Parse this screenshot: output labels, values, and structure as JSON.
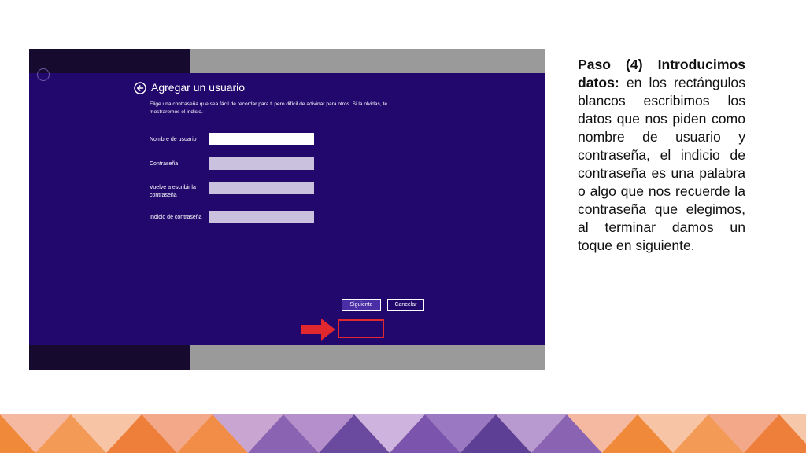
{
  "dialog": {
    "title": "Agregar un usuario",
    "description": "Elige una contraseña que sea fácil de recordar para ti pero difícil de adivinar para otros. Si la olvidas, te mostraremos el indicio.",
    "fields": [
      {
        "label": "Nombre de usuario",
        "value": ""
      },
      {
        "label": "Contraseña",
        "value": ""
      },
      {
        "label": "Vuelve a escribir la contraseña",
        "value": ""
      },
      {
        "label": "Indicio de contraseña",
        "value": ""
      }
    ],
    "buttons": {
      "next": "Siguiente",
      "cancel": "Cancelar"
    },
    "icons": {
      "back": "back-arrow-icon",
      "pointer": "red-arrow-icon"
    }
  },
  "caption": {
    "bold": "Paso (4) Introducimos datos:",
    "text": " en los rectángulos blancos escribimos los datos que nos piden como nombre de usuario y contraseña, el indicio de contraseña es una palabra o algo que nos recuerde la contraseña que elegimos, al terminar damos un toque en siguiente."
  },
  "colors": {
    "dialog_bg": "#22086d",
    "highlight": "#e1282e",
    "band_orange": "#f08a3a",
    "band_purple": "#6a4a9e",
    "band_peach": "#f5b8a0"
  }
}
